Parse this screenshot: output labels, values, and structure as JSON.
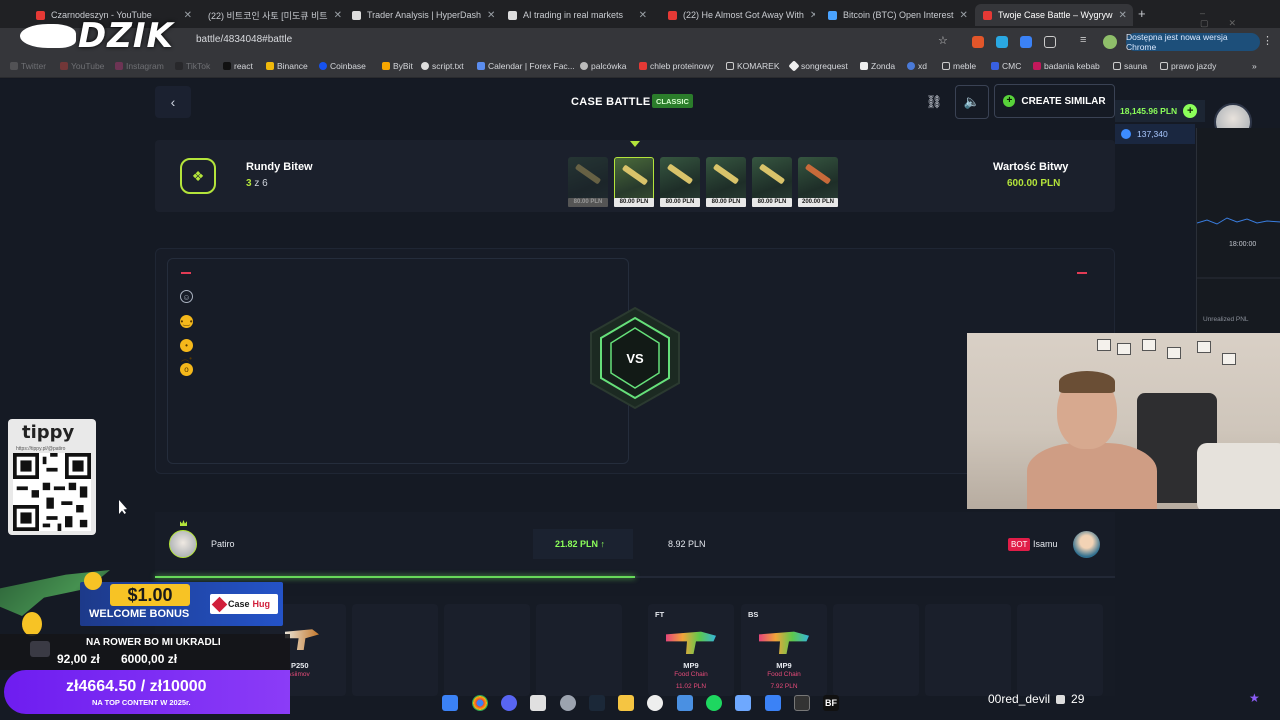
{
  "browser": {
    "tabs": [
      {
        "title": "Czarnodeszyn - YouTube",
        "color": "#e53935"
      },
      {
        "title": "(22) 비트코인 사토 [미도큐 비트",
        "color": "#e53935"
      },
      {
        "title": "Trader Analysis | HyperDash",
        "color": "#cccccc"
      },
      {
        "title": "AI trading in real markets",
        "color": "#cccccc"
      },
      {
        "title": "(22) He Almost Got Away With",
        "color": "#e53935"
      },
      {
        "title": "Bitcoin (BTC) Open Interest",
        "color": "#4aa3ff"
      },
      {
        "title": "Twoje Case Battle – Wygryw",
        "color": "#e53935"
      }
    ],
    "url": "battle/4834048#battle",
    "update_notice": "Dostępna jest nowa wersja Chrome",
    "bookmarks": [
      "Twitter",
      "YouTube",
      "Instagram",
      "TikTok",
      "react",
      "Binance",
      "Coinbase",
      "ByBit",
      "script.txt",
      "Calendar | Forex Fac...",
      "palcówka",
      "chleb proteinowy",
      "KOMAREK",
      "songrequest",
      "Zonda",
      "xd",
      "meble",
      "CMC",
      "badania kebab",
      "sauna",
      "prawo jazdy"
    ]
  },
  "overlay": {
    "logo_text": "DZIK",
    "tippy": {
      "title": "tippy",
      "url": "https://tippy.pl/@patiro"
    },
    "bonus": {
      "amount": "$1.00",
      "label": "WELCOME BONUS",
      "brand_a": "Case",
      "brand_b": "Hug"
    },
    "goal": {
      "caption": "NA ROWER BO MI UKRADLI",
      "left": "92,00 zł",
      "right": "6000,00 zł",
      "amount": "zł4664.50 / zł10000",
      "subtitle": "NA TOP CONTENT W 2025r."
    },
    "stream_name": "00red_devil",
    "stream_count": "29"
  },
  "header": {
    "title": "CASE BATTLE",
    "mode_badge": "CLASSIC",
    "create_similar": "CREATE SIMILAR",
    "balance": "18,145.96 PLN",
    "coins": "137,340"
  },
  "rounds": {
    "title": "Rundy Bitew",
    "current": "3",
    "of_label": "z",
    "total": "6",
    "value_label": "Wartość Bitwy",
    "value": "600.00 PLN",
    "cases": [
      {
        "price": "80.00 PLN",
        "state": "done"
      },
      {
        "price": "80.00 PLN",
        "state": "active"
      },
      {
        "price": "80.00 PLN",
        "state": "upcoming"
      },
      {
        "price": "80.00 PLN",
        "state": "upcoming"
      },
      {
        "price": "80.00 PLN",
        "state": "upcoming"
      },
      {
        "price": "200.00 PLN",
        "state": "upcoming"
      }
    ]
  },
  "arena": {
    "vs": "VS"
  },
  "players": {
    "p1": {
      "name": "Patiro",
      "value": "21.82 PLN ↑"
    },
    "p2": {
      "name": "Isamu",
      "value": "8.92 PLN",
      "bot_label": "BOT"
    },
    "progress": 0.5
  },
  "items": [
    {
      "grade": "",
      "name": "P250",
      "skin": "Asiimov",
      "price": "",
      "side": "left"
    },
    {
      "grade": "FT",
      "name": "MP9",
      "skin": "Food Chain",
      "price": "11.02 PLN",
      "side": "right"
    },
    {
      "grade": "BS",
      "name": "MP9",
      "skin": "Food Chain",
      "price": "7.92 PLN",
      "side": "right"
    }
  ],
  "trading_panel": {
    "time": "18:00:00",
    "label": "Unrealized PNL"
  },
  "colors": {
    "accent": "#b4e43b",
    "positive": "#8cff5a",
    "bot": "#e11d48"
  }
}
